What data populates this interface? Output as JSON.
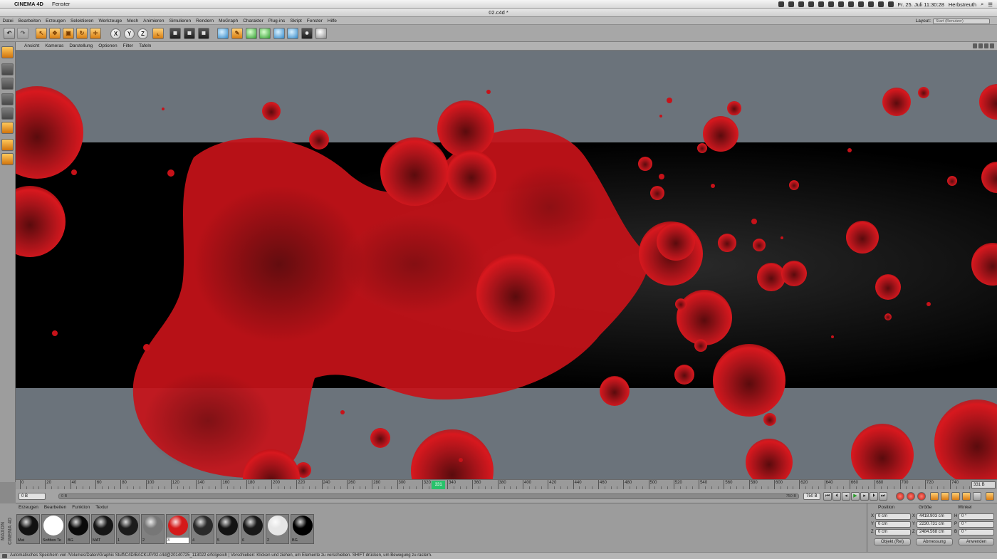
{
  "menubar": {
    "apple": "",
    "app_name": "CINEMA 4D",
    "items": [
      "Fenster"
    ],
    "clock": "Fr. 25. Juli  11:30:28",
    "user": "Herbstreuth"
  },
  "window": {
    "title": "02.c4d *"
  },
  "app_menu": {
    "items": [
      "Datei",
      "Bearbeiten",
      "Erzeugen",
      "Selektieren",
      "Werkzeuge",
      "Mesh",
      "Animieren",
      "Simulieren",
      "Rendern",
      "MoGraph",
      "Charakter",
      "Plug-ins",
      "Skript",
      "Fenster",
      "Hilfe"
    ],
    "layout_label": "Layout:",
    "layout_value": "Start (Benutzer)"
  },
  "toolbar": {
    "axis_x": "X",
    "axis_y": "Y",
    "axis_z": "Z"
  },
  "viewport_menu": {
    "items": [
      "Ansicht",
      "Kameras",
      "Darstellung",
      "Optionen",
      "Filter",
      "Tafeln"
    ]
  },
  "timeline": {
    "ticks": [
      0,
      20,
      40,
      60,
      80,
      100,
      120,
      140,
      160,
      180,
      200,
      220,
      240,
      260,
      280,
      300,
      320,
      340,
      360,
      380,
      400,
      420,
      440,
      460,
      480,
      500,
      520,
      540,
      560,
      580,
      600,
      620,
      640,
      660,
      680,
      700,
      720,
      740
    ],
    "current_frame": "331",
    "end_frame": "331 B"
  },
  "transport": {
    "start_field": "0 B",
    "range_start": "0 B",
    "range_end": "750 B",
    "end_field": "750 B"
  },
  "materials": {
    "menu": [
      "Erzeugen",
      "Bearbeiten",
      "Funktion",
      "Textur"
    ],
    "maxon_label": "MAXON CINEMA 4D",
    "items": [
      {
        "name": "Mat",
        "color": "#111111"
      },
      {
        "name": "Softbox Te",
        "color": "#ffffff"
      },
      {
        "name": "BG",
        "color": "#0a0a0a"
      },
      {
        "name": "MAT",
        "color": "#151515"
      },
      {
        "name": "1",
        "color": "#1c1c1c"
      },
      {
        "name": "2",
        "color": "#777777"
      },
      {
        "name": "3",
        "color": "#d41a1a"
      },
      {
        "name": "4",
        "color": "#2a2a2a"
      },
      {
        "name": "5",
        "color": "#141414"
      },
      {
        "name": "6",
        "color": "#181818"
      },
      {
        "name": "2",
        "color": "#e6e6e6"
      },
      {
        "name": "BG",
        "color": "#000000"
      }
    ]
  },
  "coordinates": {
    "headers": {
      "position": "Position",
      "size": "Größe",
      "rotation": "Winkel"
    },
    "rows": [
      {
        "axis": "X",
        "pos": "0 cm",
        "size_axis": "X",
        "size": "4418.903 cm",
        "rot_axis": "H",
        "rot": "0 °"
      },
      {
        "axis": "Y",
        "pos": "0 cm",
        "size_axis": "Y",
        "size": "2230.731 cm",
        "rot_axis": "P",
        "rot": "0 °"
      },
      {
        "axis": "Z",
        "pos": "0 cm",
        "size_axis": "Z",
        "size": "2484.568 cm",
        "rot_axis": "B",
        "rot": "0 °"
      }
    ],
    "mode_object": "Objekt (Rel)",
    "mode_size": "Abmessung",
    "apply": "Anwenden"
  },
  "status": {
    "text": "Automatisches Speichern von /Volumes/Daten/Graphic Stuff/C4D/BACKUP/02.c4d@20140725_113022 erfolgreich | Verschieben: Klicken und ziehen, um Elemente zu verschieben. SHIFT drücken, um Bewegung zu rastern."
  },
  "colors": {
    "viewport_bg": "#6b737b",
    "viewport_band": "#000000",
    "blob_red": "#d0141a",
    "current_frame_marker": "#29c26b"
  }
}
